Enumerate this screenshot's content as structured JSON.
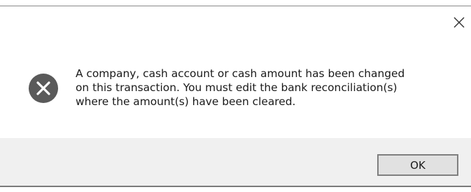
{
  "dialog": {
    "message": "A company, cash account or cash amount has been changed\non this transaction. You must edit the bank reconciliation(s)\nwhere the amount(s) have been cleared.",
    "icon": "error-icon",
    "close_icon": "close-icon",
    "ok_label": "OK"
  },
  "colors": {
    "error_icon_bg": "#5a5a5a",
    "footer_bg": "#f0f0f0",
    "button_bg": "#e1e1e1",
    "button_border": "#7f7f7f"
  }
}
